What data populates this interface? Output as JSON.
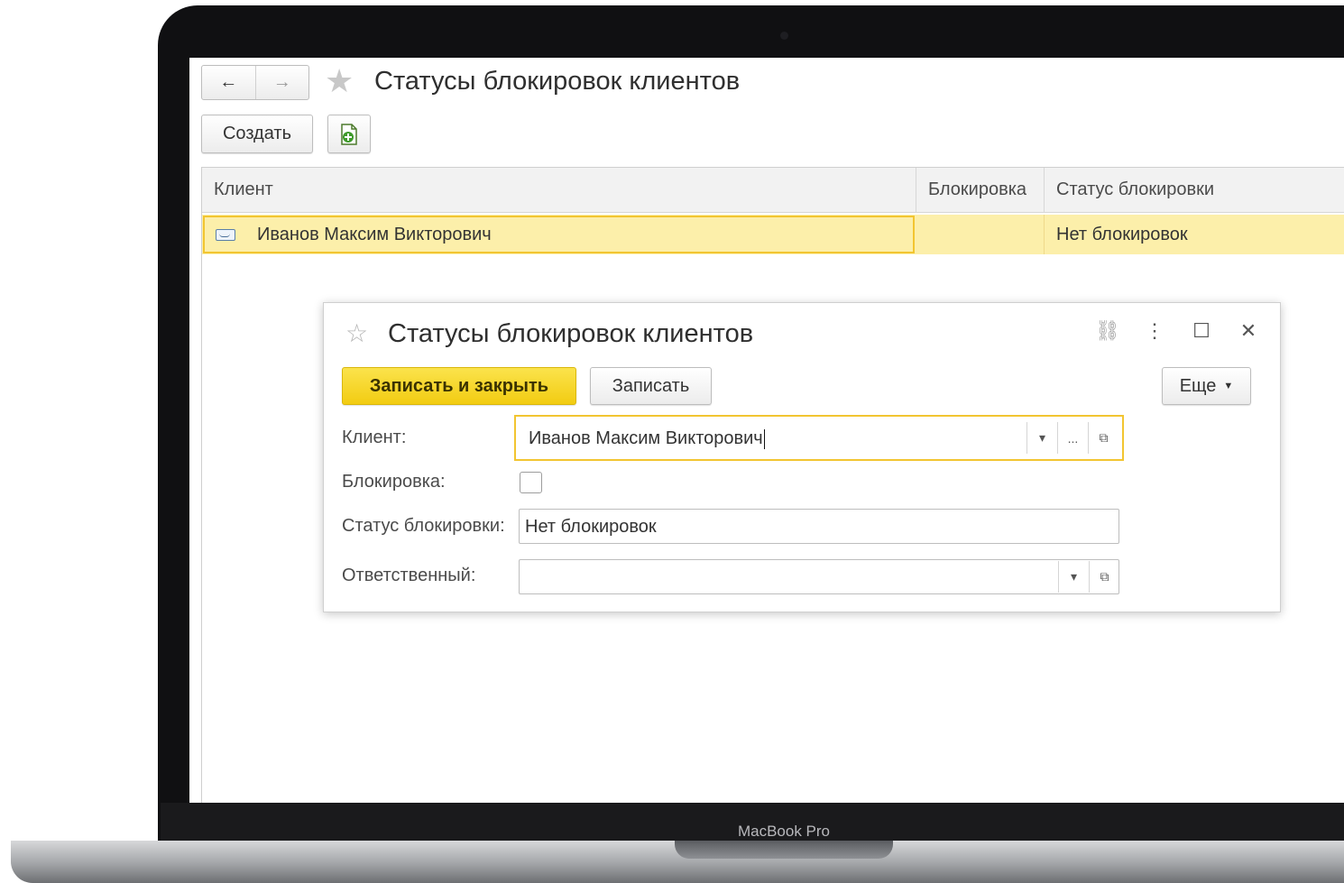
{
  "device": {
    "label": "MacBook Pro"
  },
  "main": {
    "title": "Статусы блокировок клиентов",
    "nav": {
      "back_icon": "←",
      "forward_icon": "→"
    },
    "star_icon": "★",
    "toolbar": {
      "create_label": "Создать",
      "add_doc_icon": "document-add-icon"
    },
    "table": {
      "columns": [
        "Клиент",
        "Блокировка",
        "Статус блокировки"
      ],
      "rows": [
        {
          "client": "Иванов Максим Викторович",
          "blocking": "",
          "status": "Нет блокировок"
        }
      ]
    }
  },
  "dialog": {
    "title": "Статусы блокировок клиентов",
    "star_icon": "☆",
    "window_icons": {
      "link": "⛓",
      "menu": "⋮",
      "maximize": "☐",
      "close": "✕"
    },
    "buttons": {
      "save_close": "Записать и закрыть",
      "save": "Записать",
      "more": "Еще",
      "more_caret": "▼"
    },
    "fields": {
      "client": {
        "label": "Клиент:",
        "value": "Иванов Максим Викторович"
      },
      "blocking": {
        "label": "Блокировка:",
        "checked": false
      },
      "status": {
        "label": "Статус блокировки:",
        "value": "Нет блокировок"
      },
      "responsible": {
        "label": "Ответственный:",
        "value": ""
      }
    },
    "field_buttons": {
      "dropdown": "▾",
      "select": "...",
      "open": "⧉"
    }
  },
  "colors": {
    "accent_yellow": "#f2cc12",
    "selected_row": "#fcefaa",
    "focus_border": "#f2c531"
  }
}
